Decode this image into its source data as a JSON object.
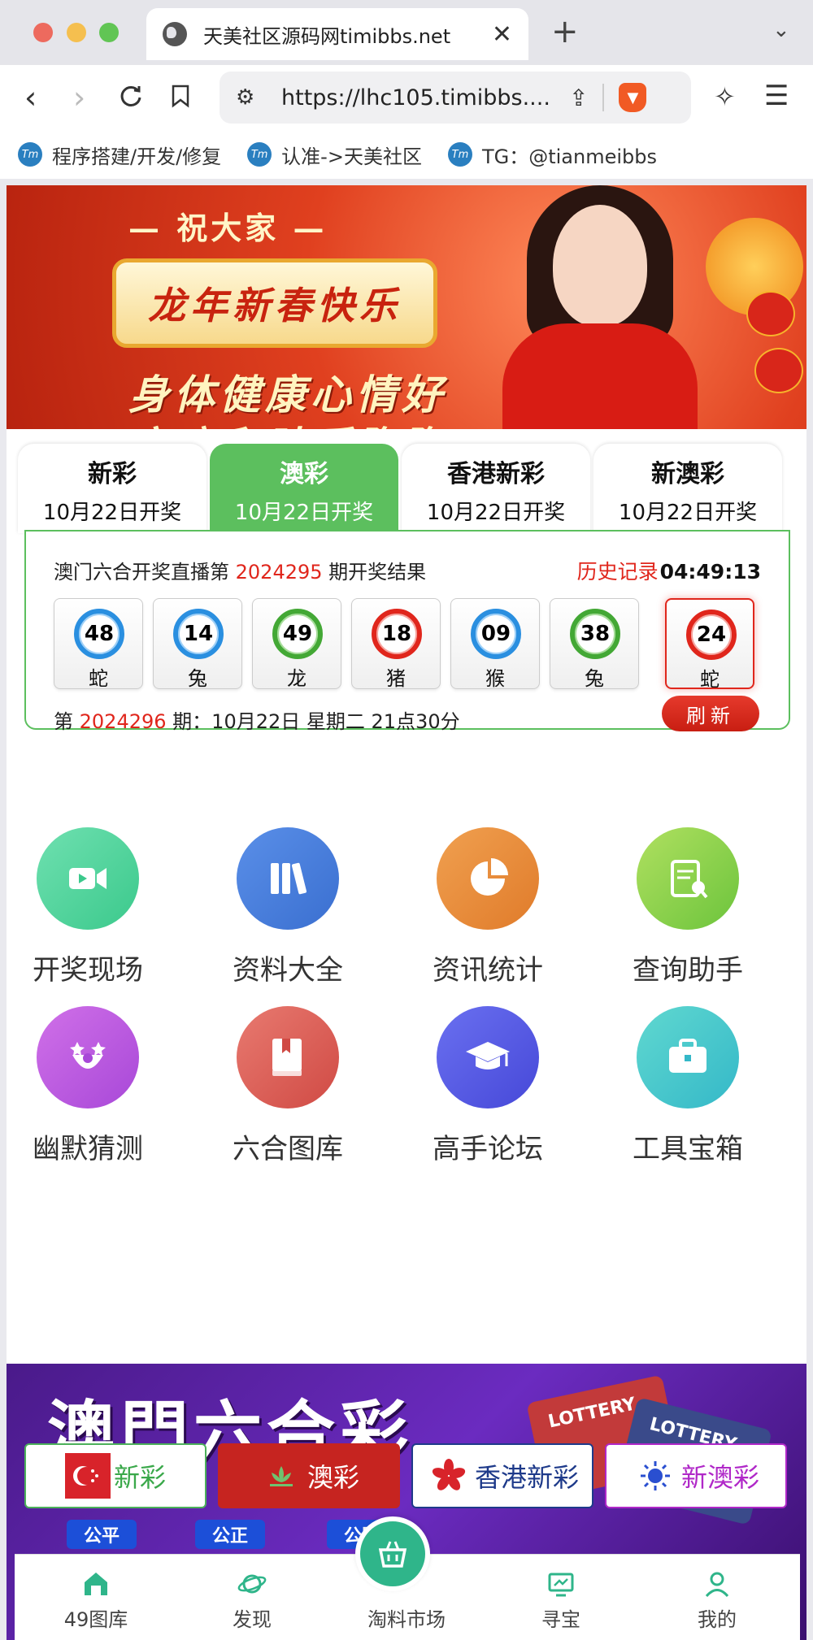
{
  "browser": {
    "tab_title": "天美社区源码网timibbs.net",
    "url": "https://lhc105.timibbs....",
    "bookmarks": [
      "程序搭建/开发/修复",
      "认准->天美社区",
      "TG：@tianmeibbs"
    ]
  },
  "banner": {
    "greeting_top": "— 祝大家 —",
    "greeting_main": "龙年新春快乐",
    "greeting_sub": "身体健康心情好",
    "greeting_sub2": "家庭和睦乐陶陶"
  },
  "lottery_tabs": [
    {
      "name": "新彩",
      "date": "10月22日开奖"
    },
    {
      "name": "澳彩",
      "date": "10月22日开奖"
    },
    {
      "name": "香港新彩",
      "date": "10月22日开奖"
    },
    {
      "name": "新澳彩",
      "date": "10月22日开奖"
    }
  ],
  "active_tab": "澳彩",
  "draw": {
    "head_prefix": "澳门六合开奖直播第",
    "period": "2024295",
    "head_suffix": "期开奖结果",
    "history_label": "历史记录",
    "clock": "04:49:13",
    "balls": [
      {
        "num": "48",
        "zodiac": "蛇",
        "color": "blue"
      },
      {
        "num": "14",
        "zodiac": "兔",
        "color": "blue"
      },
      {
        "num": "49",
        "zodiac": "龙",
        "color": "green"
      },
      {
        "num": "18",
        "zodiac": "猪",
        "color": "red"
      },
      {
        "num": "09",
        "zodiac": "猴",
        "color": "blue"
      },
      {
        "num": "38",
        "zodiac": "兔",
        "color": "green"
      },
      {
        "num": "24",
        "zodiac": "蛇",
        "color": "red"
      }
    ],
    "next_prefix": "第",
    "next_period": "2024296",
    "next_suffix": "期：10月22日 星期二 21点30分",
    "refresh_label": "刷新"
  },
  "colors": {
    "accent_green": "#5cbf5e",
    "accent_red": "#e0261c",
    "ball_blue": "#2a8fe0",
    "ball_green": "#43a835",
    "ball_red": "#e0261c"
  },
  "grid": [
    {
      "label": "开奖现场",
      "icon": "video-camera-icon"
    },
    {
      "label": "资料大全",
      "icon": "books-icon"
    },
    {
      "label": "资讯统计",
      "icon": "pie-chart-icon"
    },
    {
      "label": "查询助手",
      "icon": "search-document-icon"
    },
    {
      "label": "幽默猜测",
      "icon": "clown-face-icon"
    },
    {
      "label": "六合图库",
      "icon": "bookmark-book-icon"
    },
    {
      "label": "高手论坛",
      "icon": "graduation-cap-icon"
    },
    {
      "label": "工具宝箱",
      "icon": "briefcase-icon"
    }
  ],
  "promo": {
    "title": "澳門六合彩",
    "ticket1": "LOTTERY",
    "ticket2": "LOTTERY",
    "tabs": [
      "新彩",
      "澳彩",
      "香港新彩",
      "新澳彩"
    ],
    "pills": [
      "公平",
      "公正",
      "公開"
    ]
  },
  "bottom_nav": [
    {
      "label": "49图库",
      "icon": "home-gallery-icon"
    },
    {
      "label": "发现",
      "icon": "planet-icon"
    },
    {
      "label": "淘料市场",
      "icon": "basket-icon"
    },
    {
      "label": "寻宝",
      "icon": "monitor-icon"
    },
    {
      "label": "我的",
      "icon": "user-icon"
    }
  ]
}
